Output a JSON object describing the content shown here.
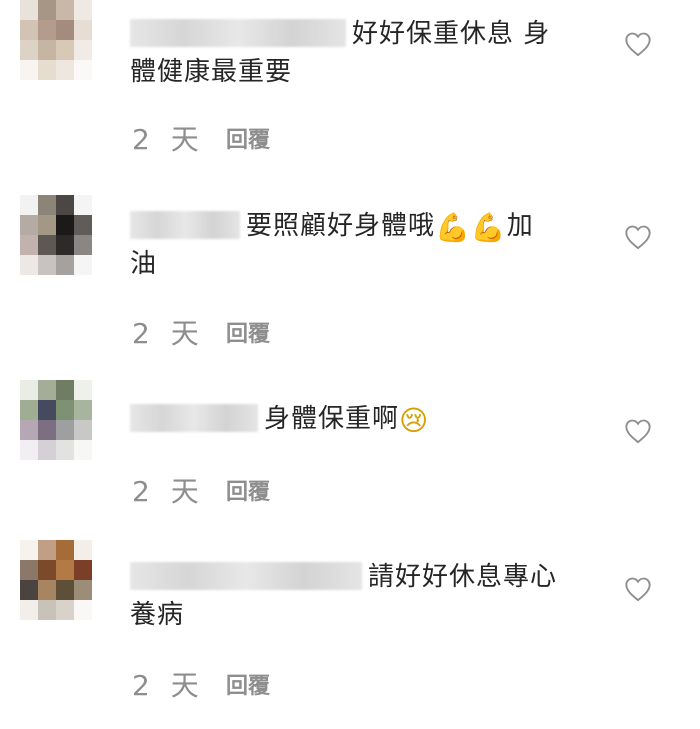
{
  "comments": [
    {
      "text_1": "好好保重休息 身",
      "text_2": "體健康最重要",
      "time": "2 天",
      "reply_label": "回覆",
      "avatar_colors": [
        "#e8e2da",
        "#a79686",
        "#c9b7a8",
        "#efe9e3",
        "#d3c3b5",
        "#b49c8c",
        "#a58b7d",
        "#e7ddd4",
        "#ddd2c6",
        "#c7b5a3",
        "#d8c9b6",
        "#f0ebe6",
        "#f7f4f1",
        "#e7ddcf",
        "#eee7df",
        "#fbf9f7"
      ]
    },
    {
      "text_1": "要照顧好身體哦",
      "emoji_1": "💪",
      "emoji_2": "💪",
      "text_1b": "加",
      "text_2": "油",
      "time": "2 天",
      "reply_label": "回覆",
      "avatar_colors": [
        "#f2f2f2",
        "#8d8478",
        "#4a4744",
        "#f4f4f4",
        "#b4aca4",
        "#a39786",
        "#1c1a19",
        "#5f5c5a",
        "#c1b2ad",
        "#5e5855",
        "#2d2b2a",
        "#8a8683",
        "#ece8e6",
        "#c8c3c0",
        "#a5a19f",
        "#f5f5f5"
      ]
    },
    {
      "text_1": "身體保重啊",
      "emoji_1": "😢",
      "time": "2 天",
      "reply_label": "回覆",
      "avatar_colors": [
        "#e9ede6",
        "#a4ad98",
        "#6f7d62",
        "#eef1eb",
        "#9fae93",
        "#454a5e",
        "#7f9173",
        "#a7b49e",
        "#b5a7b3",
        "#7c6f81",
        "#9e9fa0",
        "#c8c9c6",
        "#f1eff1",
        "#d4d0d6",
        "#e2e3e0",
        "#f7f7f6"
      ]
    },
    {
      "text_1": "請好好休息專心",
      "text_2": "養病",
      "time": "2 天",
      "reply_label": "回覆",
      "avatar_colors": [
        "#f6f2ee",
        "#c09f86",
        "#a56c38",
        "#f4eee9",
        "#8c7868",
        "#7a4a2b",
        "#b47a46",
        "#7b3e27",
        "#4b4340",
        "#a78462",
        "#5e5038",
        "#9b8d78",
        "#f2efeb",
        "#c8c2b9",
        "#d8d2cb",
        "#faf8f6"
      ]
    }
  ]
}
